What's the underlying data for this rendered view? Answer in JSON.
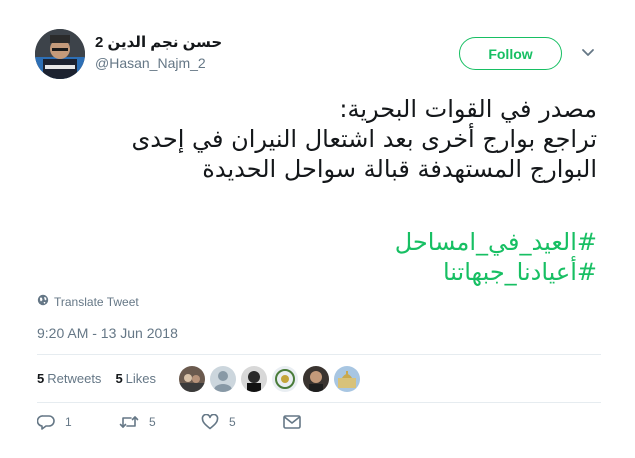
{
  "author": {
    "name": "حسن نجم الدين 2",
    "handle": "@Hasan_Najm_2"
  },
  "follow_button": {
    "label": "Follow"
  },
  "tweet": {
    "lines": [
      "مصدر في القوات البحرية:",
      "تراجع بوارج أخرى بعد اشتعال النيران في إحدى",
      "البوارج المستهدفة قبالة سواحل الحديدة"
    ],
    "hashtags": [
      "#العيد_في_امساحل",
      "#أعيادنا_جبهاتنا"
    ]
  },
  "translate_label": "Translate Tweet",
  "timestamp": "9:20 AM - 13 Jun 2018",
  "stats": {
    "retweets_count": "5",
    "retweets_label": "Retweets",
    "likes_count": "5",
    "likes_label": "Likes"
  },
  "actions": {
    "reply_count": "1",
    "retweet_count": "5",
    "like_count": "5"
  },
  "colors": {
    "accent": "#17bf63",
    "muted": "#657786",
    "text": "#14171a",
    "divider": "#e6ecf0"
  },
  "icons": {
    "caret": "chevron-down-icon",
    "translate": "globe-icon",
    "reply": "reply-icon",
    "retweet": "retweet-icon",
    "like": "heart-icon",
    "message": "envelope-icon"
  }
}
